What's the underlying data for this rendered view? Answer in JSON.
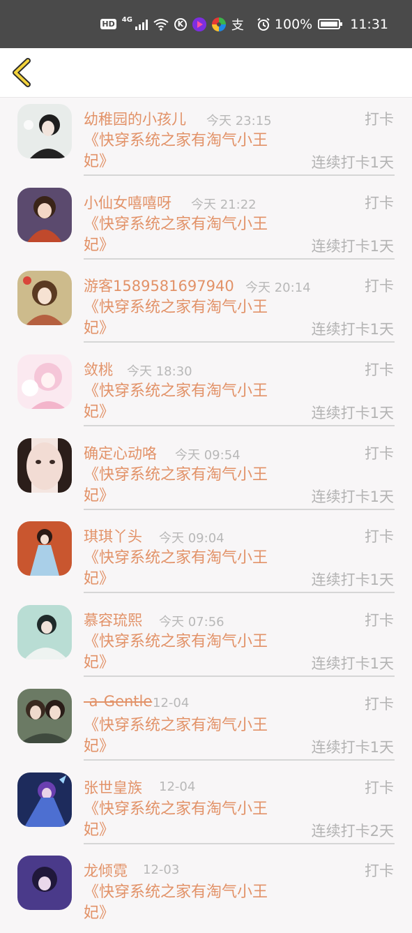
{
  "status_bar": {
    "hd": "HD",
    "network": "4G",
    "vpn_glyph": "支",
    "k_glyph": "K",
    "battery": "100%",
    "time": "11:31"
  },
  "header": {
    "back_icon": "chevron-left-icon"
  },
  "action_label": "打卡",
  "items": [
    {
      "name": "幼稚园的小孩儿",
      "time": "今天 23:15",
      "book": "《快穿系统之家有淘气小王妃》",
      "streak": "连续打卡1天"
    },
    {
      "name": "小仙女嘻嘻呀",
      "time": "今天 21:22",
      "book": "《快穿系统之家有淘气小王妃》",
      "streak": "连续打卡1天"
    },
    {
      "name": "游客1589581697940",
      "time": "今天 20:14",
      "book": "《快穿系统之家有淘气小王妃》",
      "streak": "连续打卡1天"
    },
    {
      "name": "敛桃",
      "time": "今天 18:30",
      "book": "《快穿系统之家有淘气小王妃》",
      "streak": "连续打卡1天"
    },
    {
      "name": "确定心动咯",
      "time": "今天 09:54",
      "book": "《快穿系统之家有淘气小王妃》",
      "streak": "连续打卡1天"
    },
    {
      "name": "琪琪丫头",
      "time": "今天 09:04",
      "book": "《快穿系统之家有淘气小王妃》",
      "streak": "连续打卡1天"
    },
    {
      "name": "慕容琉熙",
      "time": "今天 07:56",
      "book": "《快穿系统之家有淘气小王妃》",
      "streak": "连续打卡1天"
    },
    {
      "name": "-a-Gentle",
      "time": "12-04",
      "book": "《快穿系统之家有淘气小王妃》",
      "streak": "连续打卡1天"
    },
    {
      "name": "张世皇族",
      "time": "12-04",
      "book": "《快穿系统之家有淘气小王妃》",
      "streak": "连续打卡2天"
    },
    {
      "name": "龙倾霓",
      "time": "12-03",
      "book": "《快穿系统之家有淘气小王妃》",
      "streak": ""
    }
  ],
  "colors": {
    "accent": "#e29268",
    "muted": "#b3b3b3",
    "status_bar": "#4a4a4a",
    "back_chevron": "#f2d23c"
  }
}
